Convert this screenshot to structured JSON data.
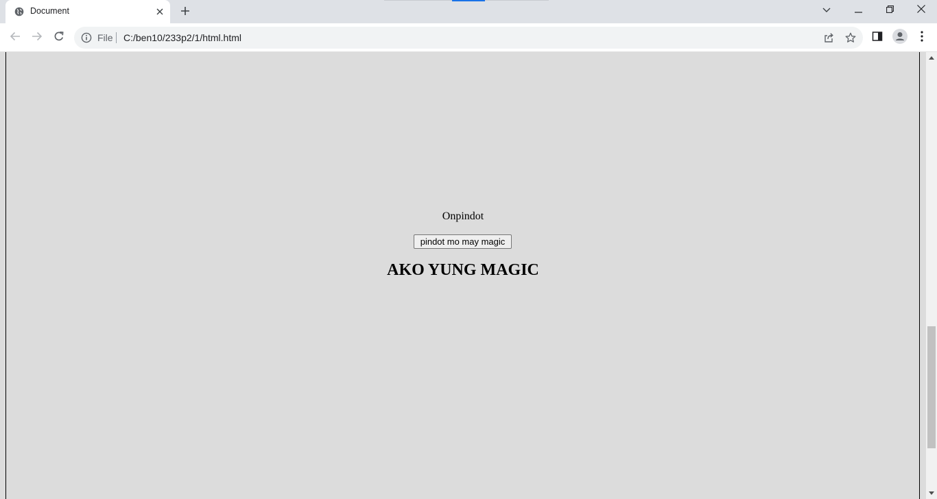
{
  "browser": {
    "tab_title": "Document",
    "address_scheme": "File",
    "address_url": "C:/ben10/233p2/1/html.html",
    "icons": {
      "favicon": "globe-icon",
      "tab_close": "close-icon",
      "new_tab": "plus-icon",
      "back": "arrow-left-icon",
      "forward": "arrow-right-icon",
      "reload": "reload-icon",
      "site_info": "info-icon",
      "share": "share-icon",
      "bookmark": "star-icon",
      "side_panel": "side-panel-icon",
      "profile": "profile-icon",
      "menu": "kebab-menu-icon",
      "tab_search": "chevron-down-icon",
      "minimize": "minimize-icon",
      "restore": "restore-icon",
      "close_window": "close-icon"
    },
    "accent_color": "#1a73e8"
  },
  "page": {
    "paragraph": "Onpindot",
    "button_label": "pindot mo may magic",
    "heading": "AKO YUNG MAGIC",
    "background_color": "#dcdcdc"
  },
  "scrollbar": {
    "position_fraction": 0.62
  }
}
